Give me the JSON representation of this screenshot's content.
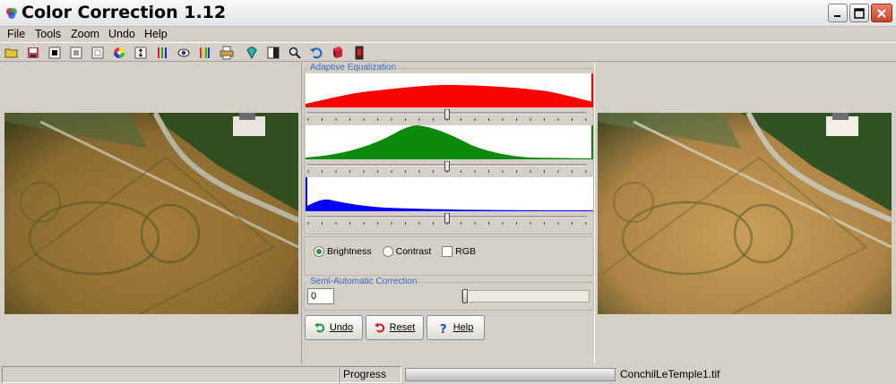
{
  "window": {
    "title": "Color Correction 1.12",
    "icon": "palette-icon"
  },
  "menu": [
    "File",
    "Tools",
    "Zoom",
    "Undo",
    "Help"
  ],
  "toolbar": {
    "icons": [
      "open-folder-icon",
      "save-icon",
      "black-point-icon",
      "gray-point-icon",
      "white-point-icon",
      "color-wheel-icon",
      "levels-icon",
      "channels-icon",
      "eye-icon",
      "bars-icon",
      "printer-icon",
      "gem-icon",
      "contrast-icon",
      "zoom-icon",
      "undo-arrow-icon",
      "book-icon",
      "exit-icon"
    ]
  },
  "adaptive": {
    "label": "Adaptive Equalization",
    "sliders": [
      {
        "channel": "red",
        "value": 0.5,
        "color": "#ff0000"
      },
      {
        "channel": "green",
        "value": 0.5,
        "color": "#0b8a0b"
      },
      {
        "channel": "blue",
        "value": 0.5,
        "color": "#0000ff"
      }
    ]
  },
  "options": {
    "brightness_label": "Brightness",
    "contrast_label": "Contrast",
    "rgb_label": "RGB",
    "selected": "Brightness",
    "rgb_checked": false
  },
  "semi": {
    "label": "Semi-Automatic Correction",
    "value": "0",
    "slider_value": 0
  },
  "buttons": {
    "undo": "Undo",
    "reset": "Reset",
    "help": "Help"
  },
  "status": {
    "progress_label": "Progress",
    "progress_value": 0,
    "filename": "ConchilLeTemple1.tif"
  }
}
